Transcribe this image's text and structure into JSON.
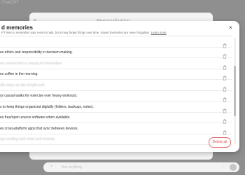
{
  "background": {
    "topbar_text": "ChatGPT",
    "panel_title": "Personalization",
    "close_glyph": "×",
    "input_placeholder": "Ask anything"
  },
  "modal": {
    "title": "d memories",
    "subtitle": "PT tries to remember your recent chats, but it may forget things over time. Saved memories are never forgotten.",
    "learn_more": "Learn more",
    "close_glyph": "×",
    "delete_all_label": "Delete all",
    "colors": {
      "danger": "#d9534f",
      "text": "#2a2a2a"
    }
  },
  "memories": [
    {
      "text": "",
      "blurred": false
    },
    {
      "text": "es ethics and responsibility in decision-making.",
      "blurred": false
    },
    {
      "text": "ws content that is casual yet informative",
      "blurred": true
    },
    {
      "text": "es coffee in the morning.",
      "blurred": false
    },
    {
      "text": "ally stays up late tonight well.",
      "blurred": true
    },
    {
      "text": "ys casual walks for exercise over heavy workouts.",
      "blurred": false
    },
    {
      "text": "s to keep things organized digitally (folders, backups, notes).",
      "blurred": false
    },
    {
      "text": "es free/open-source software when available.",
      "blurred": false
    },
    {
      "text": "es cross-platform apps that sync between devices.",
      "blurred": false
    },
    {
      "text": "ays reading tech news and reviews.",
      "blurred": true
    },
    {
      "text": "",
      "blurred": false
    }
  ]
}
